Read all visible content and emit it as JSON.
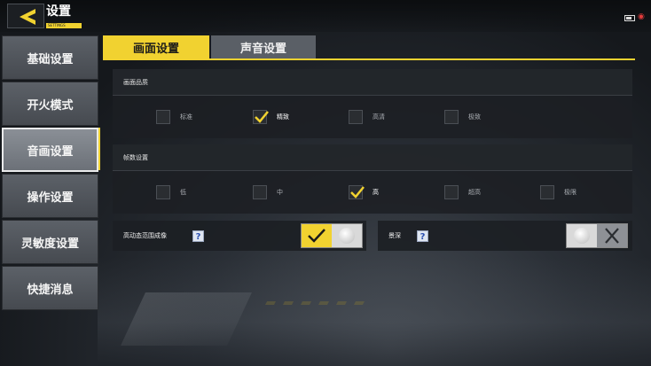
{
  "header": {
    "title": "设置",
    "subtitle": "SETTINGS"
  },
  "sidebar": {
    "items": [
      {
        "label": "基础设置",
        "active": false
      },
      {
        "label": "开火模式",
        "active": false
      },
      {
        "label": "音画设置",
        "active": true
      },
      {
        "label": "操作设置",
        "active": false
      },
      {
        "label": "灵敏度设置",
        "active": false
      },
      {
        "label": "快捷消息",
        "active": false
      }
    ]
  },
  "tabs": [
    {
      "label": "画面设置",
      "active": true
    },
    {
      "label": "声音设置",
      "active": false
    }
  ],
  "quality": {
    "heading": "画面品质",
    "options": [
      {
        "label": "标准",
        "checked": false
      },
      {
        "label": "精致",
        "checked": true
      },
      {
        "label": "高清",
        "checked": false
      },
      {
        "label": "极致",
        "checked": false
      }
    ]
  },
  "framerate": {
    "heading": "帧数设置",
    "options": [
      {
        "label": "低",
        "checked": false
      },
      {
        "label": "中",
        "checked": false
      },
      {
        "label": "高",
        "checked": true
      },
      {
        "label": "超高",
        "checked": false
      },
      {
        "label": "极限",
        "checked": false
      }
    ]
  },
  "hdr": {
    "label": "高动态范围成像",
    "help": "?",
    "enabled": true
  },
  "dof": {
    "label": "景深",
    "help": "?",
    "enabled": false
  },
  "colors": {
    "accent": "#f1d230",
    "panel": "#1c1f23",
    "sidebar": "#52575d"
  }
}
